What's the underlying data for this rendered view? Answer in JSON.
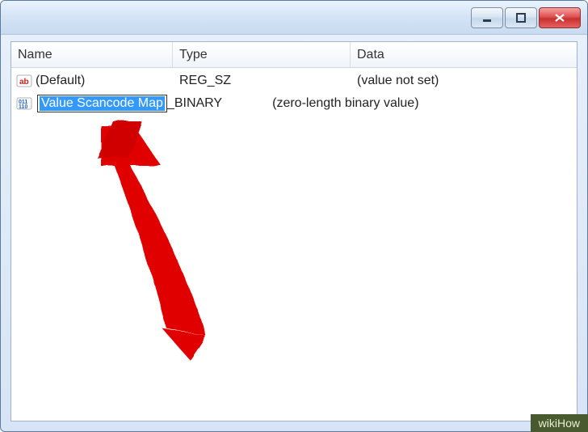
{
  "titlebar": {
    "minimize_name": "minimize-icon",
    "maximize_name": "maximize-icon",
    "close_name": "close-icon"
  },
  "columns": {
    "name": "Name",
    "type": "Type",
    "data": "Data"
  },
  "rows": [
    {
      "icon": "reg-string-icon",
      "name": "(Default)",
      "type": "REG_SZ",
      "data": "(value not set)",
      "editing": false
    },
    {
      "icon": "reg-binary-icon",
      "name": "Value Scancode Map",
      "type_suffix": "_BINARY",
      "data": "(zero-length binary value)",
      "editing": true
    }
  ],
  "watermark": "wikiHow"
}
